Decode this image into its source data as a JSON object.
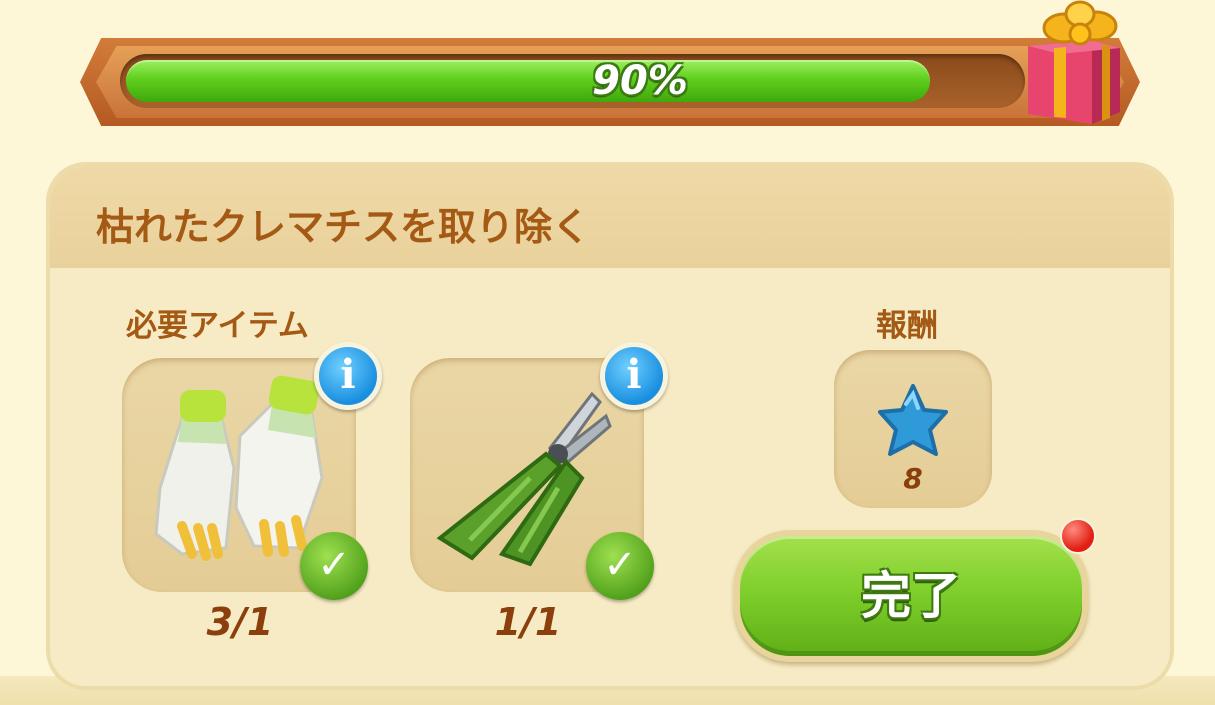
{
  "progress": {
    "percent_label": "90%",
    "fraction": 0.9
  },
  "quest": {
    "title": "枯れたクレマチスを取り除く",
    "required_items_label": "必要アイテム",
    "reward_label": "報酬",
    "items": [
      {
        "icon": "gardening-gloves-icon",
        "count": "3/1",
        "status": "complete"
      },
      {
        "icon": "pruning-shears-icon",
        "count": "1/1",
        "status": "complete"
      }
    ],
    "reward": {
      "icon": "blue-star-icon",
      "count": "8"
    },
    "complete_button_label": "完了"
  },
  "colors": {
    "text_brown": "#a45a14",
    "progress_green": "#5fcf1c",
    "button_green": "#7ccd2a",
    "info_blue": "#1a8fe0",
    "notification_red": "#e21f12"
  }
}
